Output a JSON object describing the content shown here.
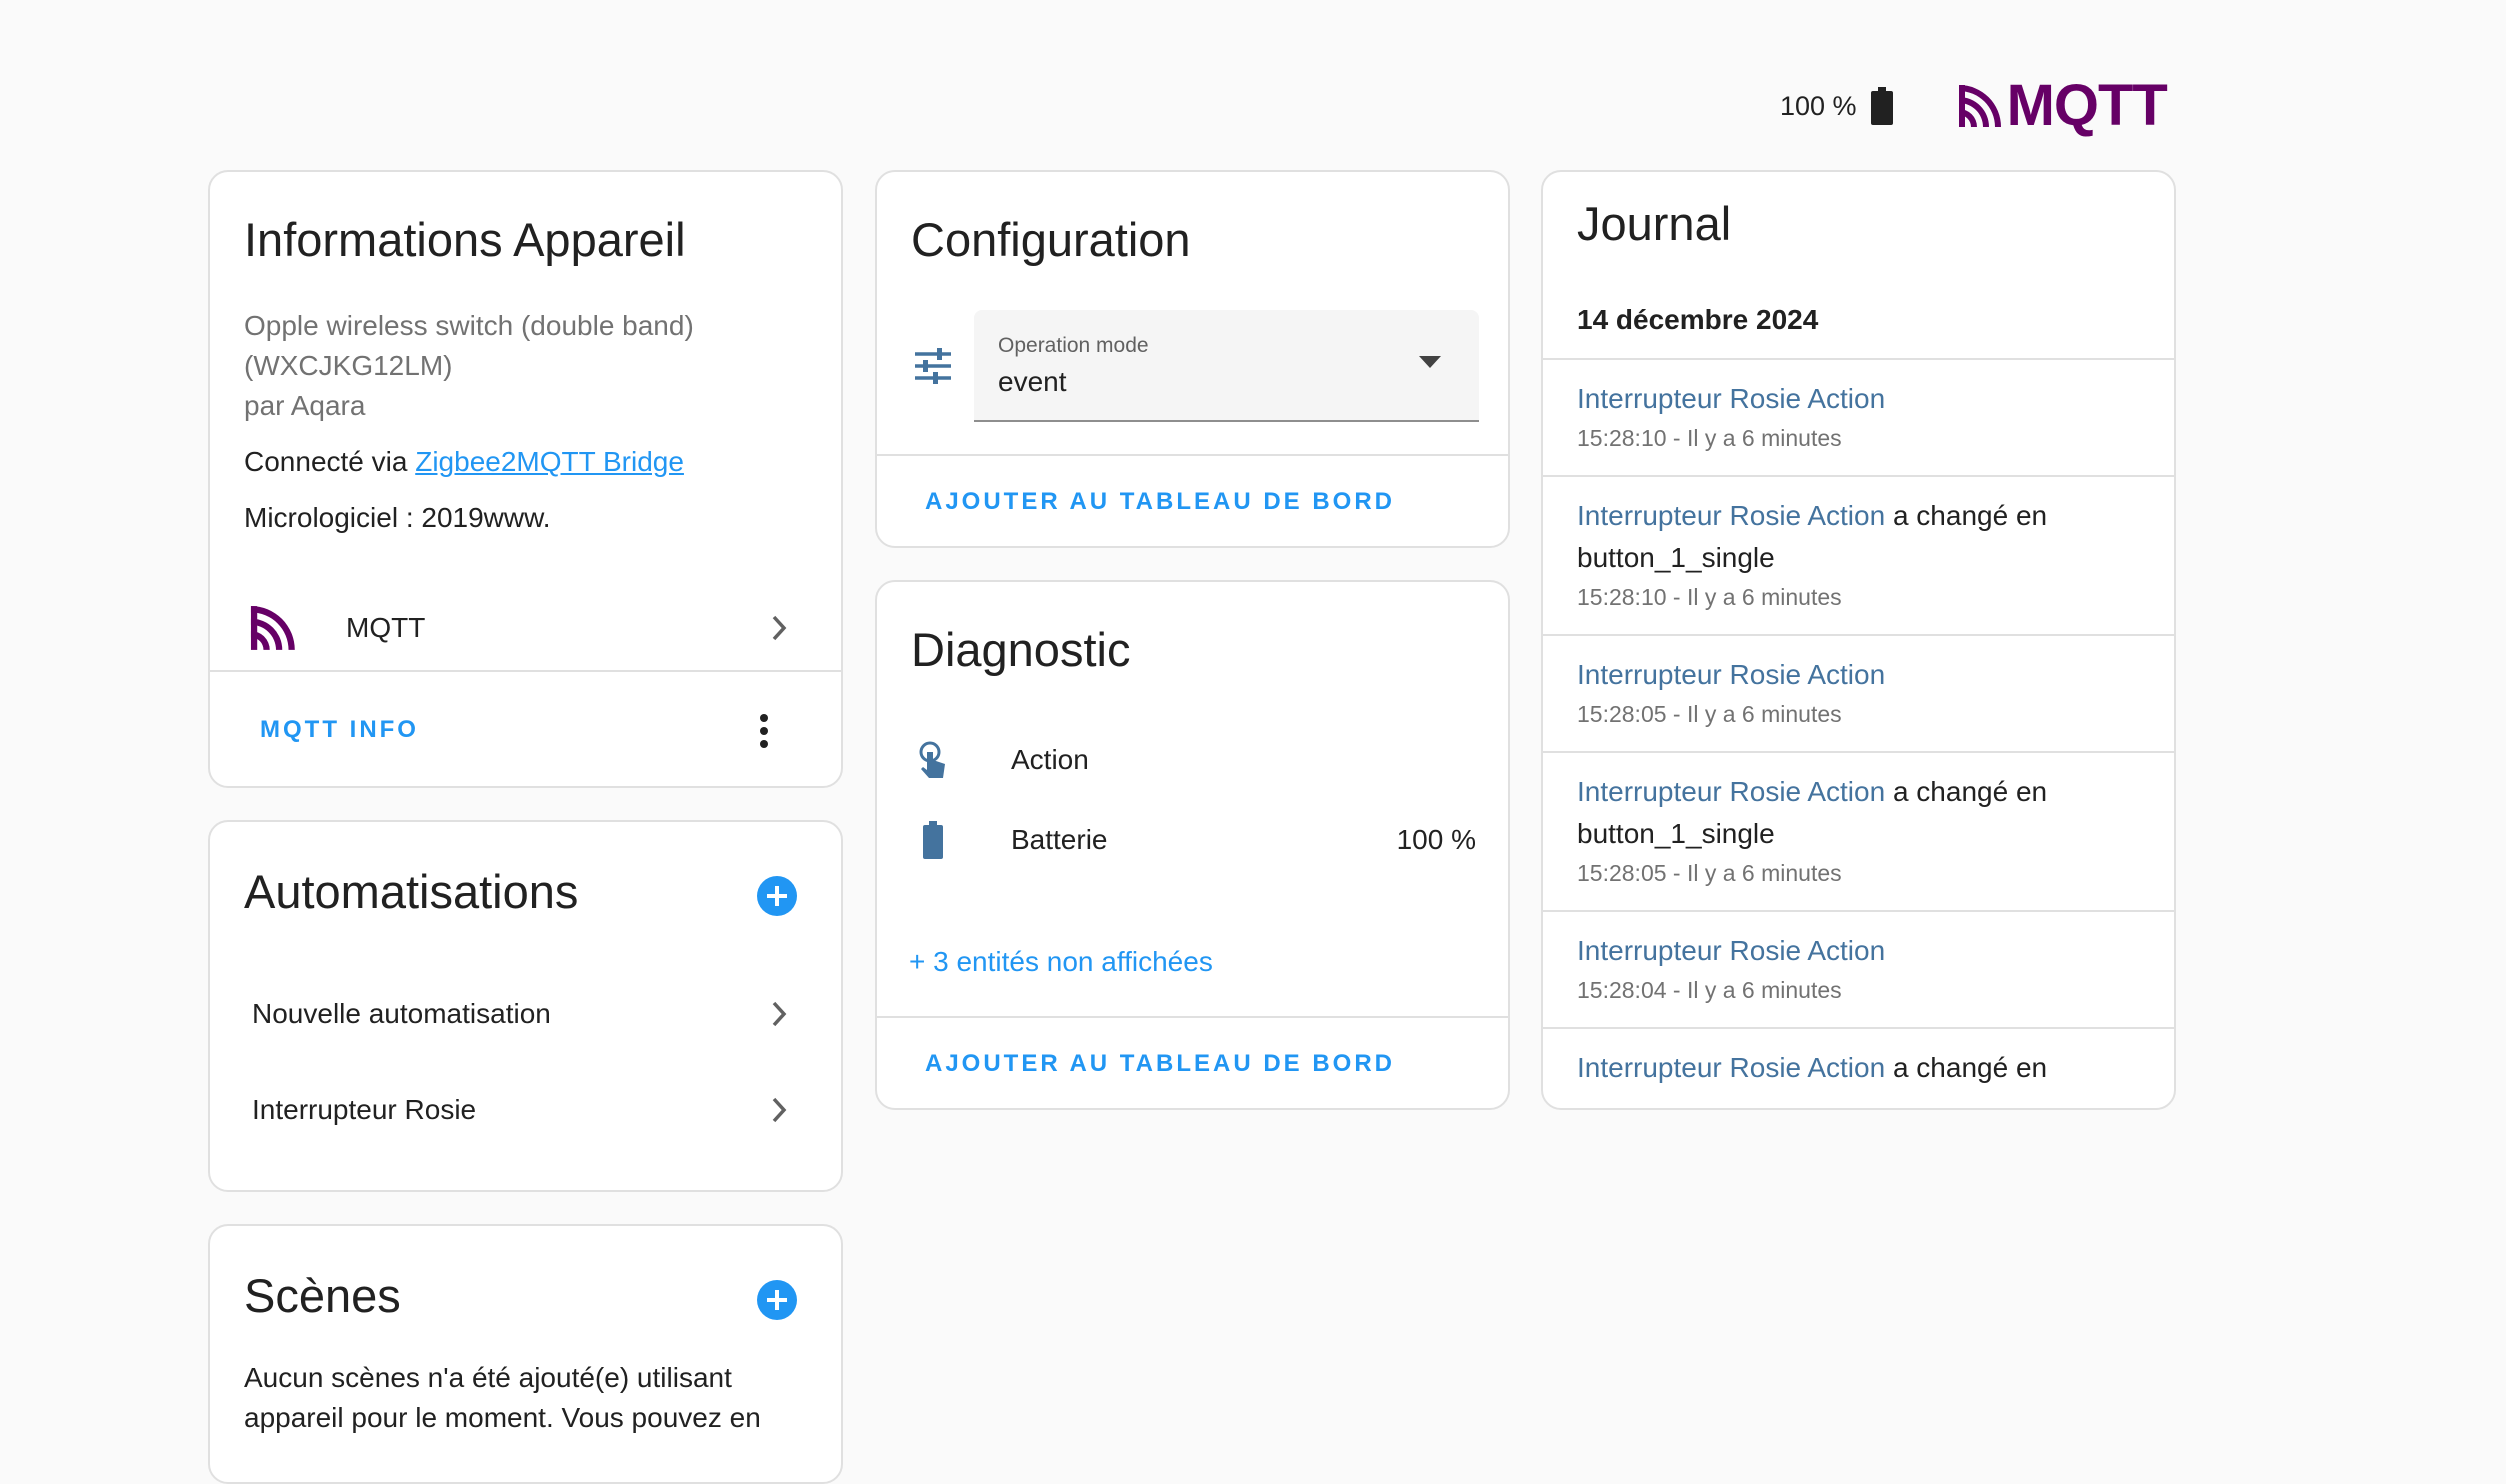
{
  "topbar": {
    "battery_text": "100 %",
    "brand": "MQTT"
  },
  "colors": {
    "accent": "#2196f3",
    "brand": "#660066",
    "entity": "#44739e",
    "icon": "#44739e"
  },
  "info": {
    "title": "Informations Appareil",
    "model_line1": "Opple wireless switch (double band)",
    "model_line2": "(WXCJKG12LM)",
    "manufacturer": "par Aqara",
    "connected_prefix": "Connecté via ",
    "connected_link": "Zigbee2MQTT Bridge",
    "firmware": "Micrologiciel : 2019www.",
    "integration_label": "MQTT",
    "action_label": "MQTT INFO"
  },
  "automations": {
    "title": "Automatisations",
    "items": [
      {
        "label": "Nouvelle automatisation"
      },
      {
        "label": "Interrupteur Rosie"
      }
    ]
  },
  "scenes": {
    "title": "Scènes",
    "text": "Aucun scènes n'a été ajouté(e) utilisant appareil pour le moment. Vous pouvez en"
  },
  "configuration": {
    "title": "Configuration",
    "select_label": "Operation mode",
    "select_value": "event",
    "action_label": "AJOUTER AU TABLEAU DE BORD"
  },
  "diagnostic": {
    "title": "Diagnostic",
    "entities": [
      {
        "name": "Action",
        "value": "",
        "icon": "gesture-tap-icon"
      },
      {
        "name": "Batterie",
        "value": "100 %",
        "icon": "battery-icon"
      }
    ],
    "more_link": "+ 3 entités non affichées",
    "action_label": "AJOUTER AU TABLEAU DE BORD"
  },
  "journal": {
    "title": "Journal",
    "date": "14 décembre 2024",
    "entries": [
      {
        "entity": "Interrupteur Rosie Action",
        "message": "",
        "value": "",
        "time": "15:28:10 - Il y a 6 minutes"
      },
      {
        "entity": "Interrupteur Rosie Action",
        "message": " a changé en",
        "value": "button_1_single",
        "time": "15:28:10 - Il y a 6 minutes"
      },
      {
        "entity": "Interrupteur Rosie Action",
        "message": "",
        "value": "",
        "time": "15:28:05 - Il y a 6 minutes"
      },
      {
        "entity": "Interrupteur Rosie Action",
        "message": " a changé en",
        "value": "button_1_single",
        "time": "15:28:05 - Il y a 6 minutes"
      },
      {
        "entity": "Interrupteur Rosie Action",
        "message": "",
        "value": "",
        "time": "15:28:04 - Il y a 6 minutes"
      },
      {
        "entity": "Interrupteur Rosie Action",
        "message": " a changé en",
        "value": "",
        "time": ""
      }
    ]
  }
}
